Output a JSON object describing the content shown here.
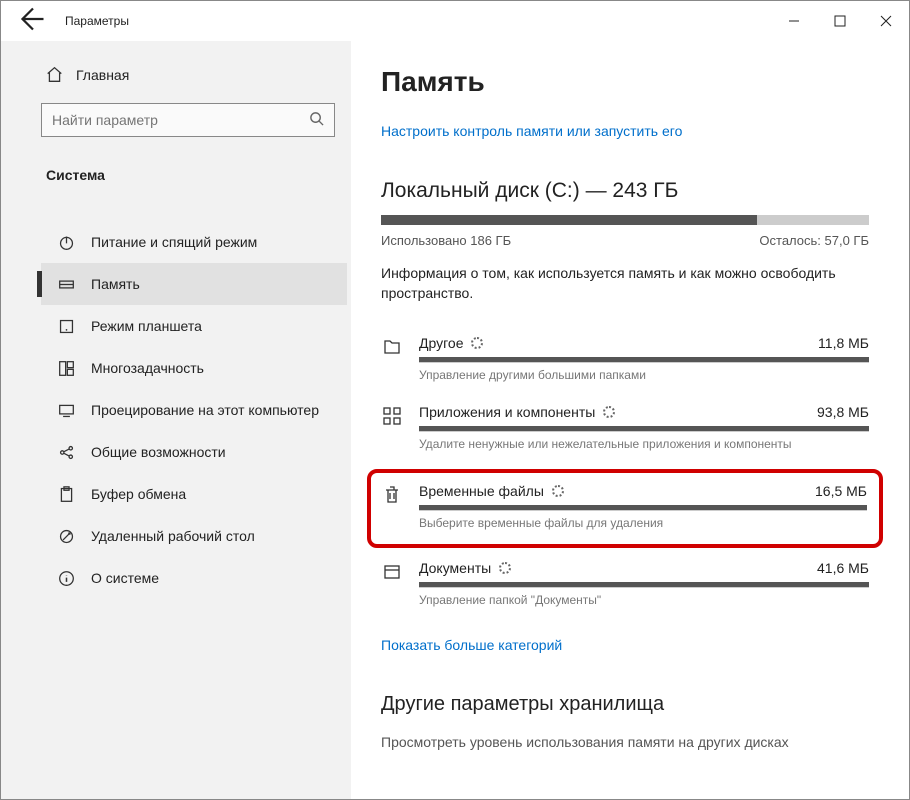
{
  "titlebar": {
    "title": "Параметры"
  },
  "sidebar": {
    "home": "Главная",
    "search_placeholder": "Найти параметр",
    "section": "Система",
    "items": [
      {
        "label": ""
      },
      {
        "label": "Питание и спящий режим"
      },
      {
        "label": "Память"
      },
      {
        "label": "Режим планшета"
      },
      {
        "label": "Многозадачность"
      },
      {
        "label": "Проецирование на этот компьютер"
      },
      {
        "label": "Общие возможности"
      },
      {
        "label": "Буфер обмена"
      },
      {
        "label": "Удаленный рабочий стол"
      },
      {
        "label": "О системе"
      }
    ]
  },
  "main": {
    "title": "Память",
    "configure_link": "Настроить контроль памяти или запустить его",
    "disk_title": "Локальный диск (C:) — 243 ГБ",
    "used_label": "Использовано 186 ГБ",
    "free_label": "Осталось: 57,0 ГБ",
    "desc": "Информация о том, как используется память и как можно освободить пространство.",
    "categories": [
      {
        "name": "Другое",
        "size": "11,8 МБ",
        "sub": "Управление другими большими папками"
      },
      {
        "name": "Приложения и компоненты",
        "size": "93,8 МБ",
        "sub": "Удалите ненужные или нежелательные приложения и компоненты"
      },
      {
        "name": "Временные файлы",
        "size": "16,5 МБ",
        "sub": "Выберите временные файлы для удаления"
      },
      {
        "name": "Документы",
        "size": "41,6 МБ",
        "sub": "Управление папкой \"Документы\""
      }
    ],
    "show_more": "Показать больше категорий",
    "other_section": "Другие параметры хранилища",
    "other_desc": "Просмотреть уровень использования памяти на других дисках"
  }
}
